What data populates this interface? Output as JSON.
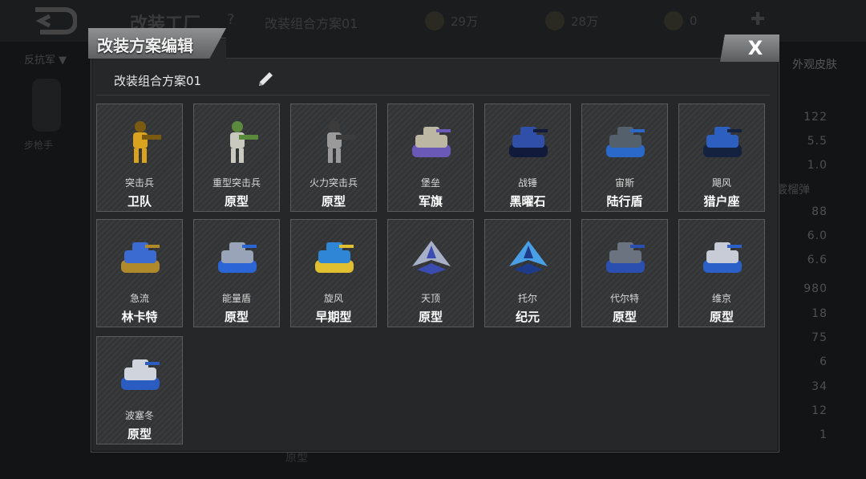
{
  "background": {
    "screen_title": "改装工厂",
    "help": "?",
    "plan_name": "改装组合方案01",
    "resources": [
      {
        "icon": "coin-icon",
        "value": "29万"
      },
      {
        "icon": "diamond-icon",
        "value": "28万"
      },
      {
        "icon": "medal-icon",
        "value": "0"
      }
    ],
    "faction": "反抗军 ▼",
    "left_unit": "步枪手",
    "skin_tab": "外观皮肤",
    "right_label": "霰榴弹",
    "stats": [
      "122",
      "5.5",
      "1.0",
      "88",
      "6.0",
      "6.6",
      "980",
      "18",
      "75",
      "6",
      "34",
      "12",
      "1"
    ],
    "bottom_text": "原型"
  },
  "dialog": {
    "title": "改装方案编辑",
    "close_label": "X",
    "preset_name": "改装组合方案01",
    "units": [
      {
        "name": "突击兵",
        "variant": "卫队",
        "icon": "soldier-yellow"
      },
      {
        "name": "重型突击兵",
        "variant": "原型",
        "icon": "mech-soldier"
      },
      {
        "name": "火力突击兵",
        "variant": "原型",
        "icon": "soldier-grey"
      },
      {
        "name": "堡垒",
        "variant": "军旗",
        "icon": "fortress-tank"
      },
      {
        "name": "战锤",
        "variant": "黑曜石",
        "icon": "warhammer-tank"
      },
      {
        "name": "宙斯",
        "variant": "陆行盾",
        "icon": "zeus-tank"
      },
      {
        "name": "飓风",
        "variant": "猎户座",
        "icon": "hurricane-tank"
      },
      {
        "name": "急流",
        "variant": "林卡特",
        "icon": "rapids-launcher"
      },
      {
        "name": "能量盾",
        "variant": "原型",
        "icon": "energy-shield-tank"
      },
      {
        "name": "旋风",
        "variant": "早期型",
        "icon": "whirlwind-hover"
      },
      {
        "name": "天顶",
        "variant": "原型",
        "icon": "zenith-jet"
      },
      {
        "name": "托尔",
        "variant": "纪元",
        "icon": "thor-jet"
      },
      {
        "name": "代尔特",
        "variant": "原型",
        "icon": "delta-apc"
      },
      {
        "name": "维京",
        "variant": "原型",
        "icon": "viking-hover"
      },
      {
        "name": "波塞冬",
        "variant": "原型",
        "icon": "poseidon-hover"
      }
    ]
  }
}
